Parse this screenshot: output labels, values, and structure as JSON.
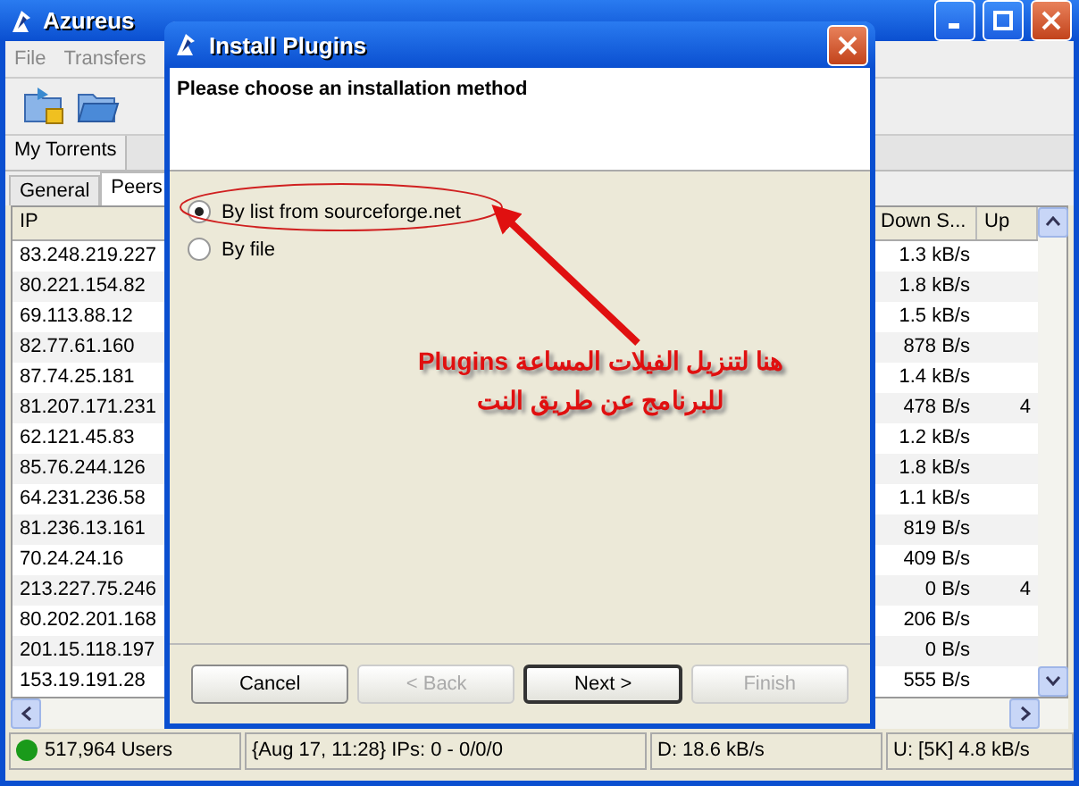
{
  "main_window": {
    "title": "Azureus",
    "menu": [
      "File",
      "Transfers"
    ],
    "tabs": [
      {
        "label": "My Torrents"
      }
    ],
    "subtabs": [
      {
        "label": "General",
        "selected": false
      },
      {
        "label": "Peers",
        "selected": true
      }
    ],
    "table": {
      "columns": [
        "IP",
        "Down S...",
        "Up"
      ],
      "rows": [
        [
          "83.248.219.227",
          "1.3 kB/s",
          ""
        ],
        [
          "80.221.154.82",
          "1.8 kB/s",
          ""
        ],
        [
          "69.113.88.12",
          "1.5 kB/s",
          ""
        ],
        [
          "82.77.61.160",
          "878 B/s",
          ""
        ],
        [
          "87.74.25.181",
          "1.4 kB/s",
          ""
        ],
        [
          "81.207.171.231",
          "478 B/s",
          "4"
        ],
        [
          "62.121.45.83",
          "1.2 kB/s",
          ""
        ],
        [
          "85.76.244.126",
          "1.8 kB/s",
          ""
        ],
        [
          "64.231.236.58",
          "1.1 kB/s",
          ""
        ],
        [
          "81.236.13.161",
          "819 B/s",
          ""
        ],
        [
          "70.24.24.16",
          "409 B/s",
          ""
        ],
        [
          "213.227.75.246",
          "0 B/s",
          "4"
        ],
        [
          "80.202.201.168",
          "206 B/s",
          ""
        ],
        [
          "201.15.118.197",
          "0 B/s",
          ""
        ],
        [
          "153.19.191.28",
          "555 B/s",
          ""
        ]
      ]
    },
    "status_bar": [
      "517,964 Users",
      "{Aug 17, 11:28} IPs: 0 - 0/0/0",
      "D: 18.6 kB/s",
      "U: [5K] 4.8 kB/s"
    ]
  },
  "dialog": {
    "title": "Install Plugins",
    "heading": "Please choose an installation method",
    "options": [
      {
        "label": "By list from sourceforge.net",
        "selected": true
      },
      {
        "label": "By file",
        "selected": false
      }
    ],
    "annotation": [
      "هنا لتنزيل الفيلات المساعة  Plugins",
      "للبرنامج عن طريق النت"
    ],
    "buttons": [
      {
        "label": "Cancel",
        "disabled": false,
        "default": false
      },
      {
        "label": "< Back",
        "disabled": true,
        "default": false
      },
      {
        "label": "Next >",
        "disabled": false,
        "default": true
      },
      {
        "label": "Finish",
        "disabled": true,
        "default": false
      }
    ]
  }
}
